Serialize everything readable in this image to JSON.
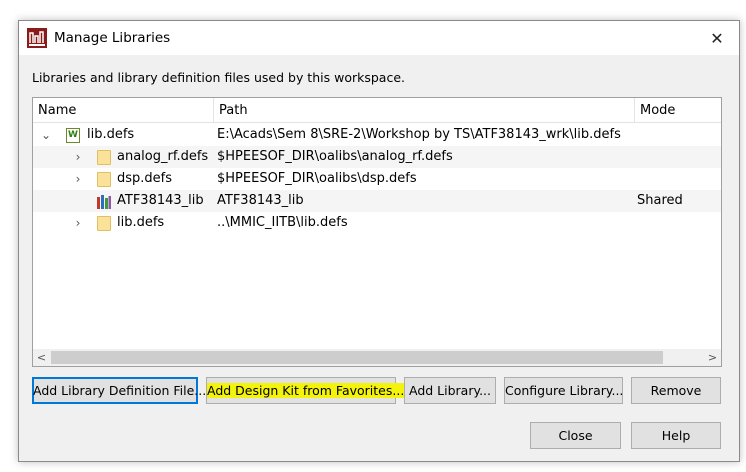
{
  "window": {
    "title": "Manage Libraries",
    "close_glyph": "✕"
  },
  "caption": "Libraries and library definition files used by this workspace.",
  "columns": {
    "name": "Name",
    "path": "Path",
    "mode": "Mode"
  },
  "rows": [
    {
      "name": "lib.defs",
      "path": "E:\\Acads\\Sem 8\\SRE-2\\Workshop by TS\\ATF38143_wrk\\lib.defs",
      "mode": "",
      "icon": "workspace-defs-icon",
      "expander": "expanded",
      "level": 0
    },
    {
      "name": "analog_rf.defs",
      "path": "$HPEESOF_DIR\\oalibs\\analog_rf.defs",
      "mode": "",
      "icon": "folder-icon",
      "expander": "collapsed",
      "level": 1
    },
    {
      "name": "dsp.defs",
      "path": "$HPEESOF_DIR\\oalibs\\dsp.defs",
      "mode": "",
      "icon": "folder-icon",
      "expander": "collapsed",
      "level": 1
    },
    {
      "name": "ATF38143_lib",
      "path": "ATF38143_lib",
      "mode": "Shared",
      "icon": "library-icon",
      "expander": "none",
      "level": 1
    },
    {
      "name": "lib.defs",
      "path": "..\\MMIC_IITB\\lib.defs",
      "mode": "",
      "icon": "folder-icon",
      "expander": "collapsed",
      "level": 1
    }
  ],
  "scroll": {
    "left_glyph": "<",
    "right_glyph": ">"
  },
  "buttons": {
    "add_definition": "Add Library Definition File...",
    "add_design_kit": "Add Design Kit from Favorites...",
    "add_library": "Add Library...",
    "configure_library": "Configure Library...",
    "remove": "Remove",
    "close": "Close",
    "help": "Help"
  },
  "glyphs": {
    "expanded": "⌄",
    "collapsed": "›"
  },
  "colors": {
    "highlight": "#f3f30e",
    "focus": "#0078d7",
    "folder": "#fbe29a"
  }
}
